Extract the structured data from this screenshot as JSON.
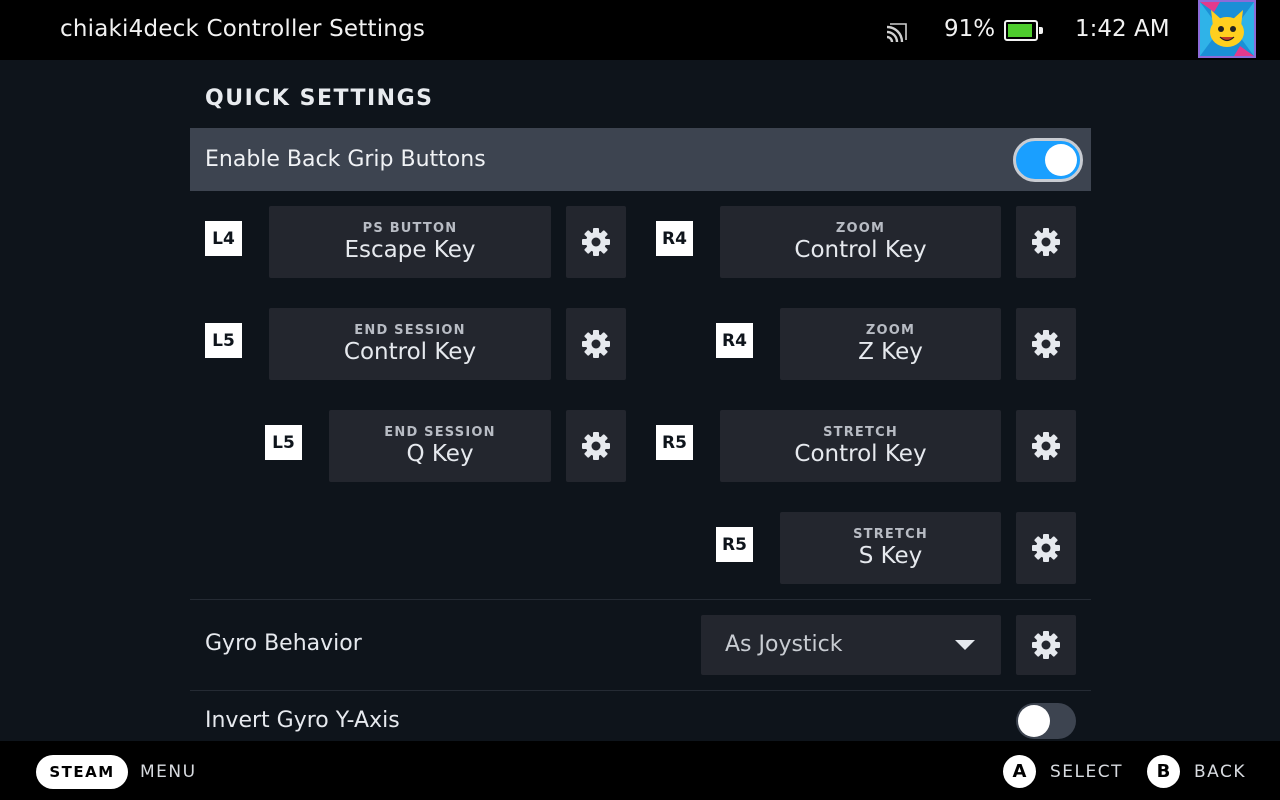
{
  "topbar": {
    "title": "chiaki4deck Controller Settings",
    "battery_percent": "91%",
    "battery_level": 0.91,
    "clock": "1:42 AM",
    "icons": [
      "cast-icon",
      "battery-icon",
      "avatar"
    ]
  },
  "section": {
    "title": "QUICK SETTINGS"
  },
  "back_grip": {
    "label": "Enable Back Grip Buttons",
    "enabled": true
  },
  "bindings": [
    {
      "key": "L4",
      "category": "PS BUTTON",
      "value": "Escape Key"
    },
    {
      "key": "R4",
      "category": "ZOOM",
      "value": "Control Key"
    },
    {
      "key": "L5",
      "category": "END SESSION",
      "value": "Control Key"
    },
    {
      "key": "R4",
      "category": "ZOOM",
      "value": "Z Key"
    },
    {
      "key": "L5",
      "category": "END SESSION",
      "value": "Q Key"
    },
    {
      "key": "R5",
      "category": "STRETCH",
      "value": "Control Key"
    },
    {
      "key": "R5",
      "category": "STRETCH",
      "value": "S Key"
    }
  ],
  "gyro": {
    "label": "Gyro Behavior",
    "value": "As Joystick"
  },
  "invert_gyro": {
    "label": "Invert Gyro Y-Axis",
    "enabled": false
  },
  "bottombar": {
    "steam_label": "STEAM",
    "menu_label": "MENU",
    "a_button": "A",
    "select_label": "SELECT",
    "b_button": "B",
    "back_label": "BACK"
  },
  "colors": {
    "background": "#0e141b",
    "accent": "#1a9fff",
    "panel": "#23262e",
    "highlight_row": "#3d4450",
    "battery": "#4ecc2d"
  }
}
